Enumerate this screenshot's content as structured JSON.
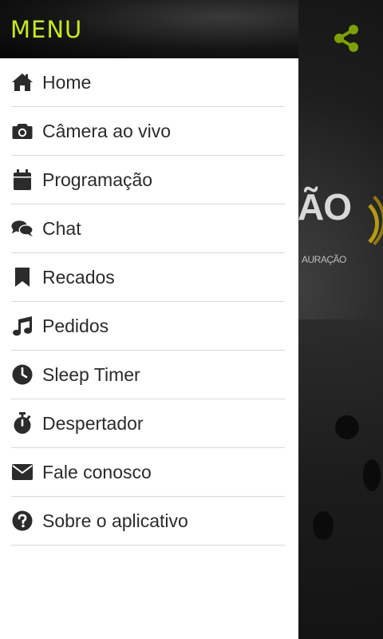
{
  "drawer": {
    "title": "MENU",
    "accent_color": "#c6ea1a",
    "items": [
      {
        "label": "Home",
        "icon": "home-icon"
      },
      {
        "label": "Câmera ao vivo",
        "icon": "camera-icon"
      },
      {
        "label": "Programação",
        "icon": "calendar-icon"
      },
      {
        "label": "Chat",
        "icon": "chat-icon"
      },
      {
        "label": "Recados",
        "icon": "bookmark-icon"
      },
      {
        "label": "Pedidos",
        "icon": "music-icon"
      },
      {
        "label": "Sleep Timer",
        "icon": "clock-icon"
      },
      {
        "label": "Despertador",
        "icon": "stopwatch-icon"
      },
      {
        "label": "Fale conosco",
        "icon": "envelope-icon"
      },
      {
        "label": "Sobre o aplicativo",
        "icon": "question-circle-icon"
      }
    ]
  },
  "background": {
    "logo_text": "ÃO",
    "logo_subtext": "AURAÇÃO",
    "share_icon": "share-icon",
    "share_color": "#7ea100"
  }
}
